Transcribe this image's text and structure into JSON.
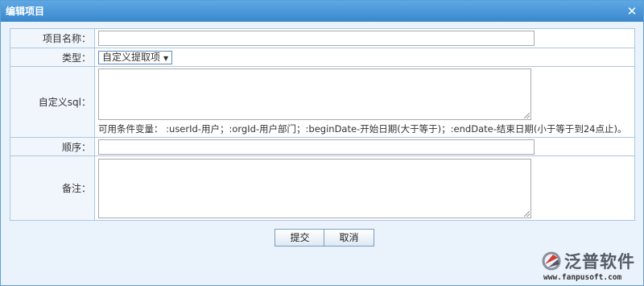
{
  "dialog": {
    "title": "编辑项目",
    "close_glyph": "✕"
  },
  "form": {
    "name_label": "项目名称：",
    "name_value": "",
    "type_label": "类型：",
    "type_selected": "自定义提取项",
    "sql_label": "自定义sql：",
    "sql_value": "",
    "sql_hint": "可用条件变量： :userId-用户；:orgId-用户部门；:beginDate-开始日期(大于等于)；:endDate-结束日期(小于等于到24点止)。",
    "order_label": "顺序：",
    "order_value": "",
    "remark_label": "备注：",
    "remark_value": ""
  },
  "buttons": {
    "submit": "提交",
    "cancel": "取消"
  },
  "watermark": {
    "brand": "泛普软件",
    "url": "www.fanpusoft.com"
  },
  "colors": {
    "titlebar": "#3a87cc",
    "border": "#a9c7e4",
    "background": "#eaf3fb"
  }
}
